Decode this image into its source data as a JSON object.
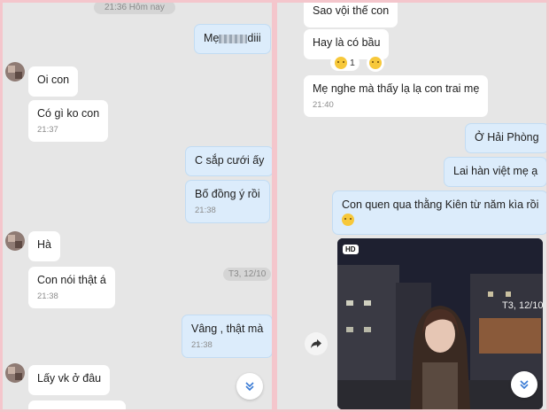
{
  "left": {
    "date_pill": "21:36 Hôm nay",
    "msg_me_prefix": "Mẹ",
    "msg_me_suffix": "diii",
    "msg_oicon": "Oi con",
    "msg_cogi": "Có gì ko con",
    "time_2137": "21:37",
    "msg_csap": "C sắp cưới ấy",
    "msg_bodong": "Bố đồng ý rồi",
    "time_2138a": "21:38",
    "msg_ha": "Hà",
    "msg_connoi": "Con nói thật á",
    "time_2138b": "21:38",
    "date_pill2": "T3, 12/10",
    "msg_vang": "Vâng , thật mà",
    "time_2138c": "21:38",
    "msg_layvk": "Lấy vk ở đâu"
  },
  "right": {
    "msg_saovoi": "Sao vội thế con",
    "msg_haylaco": "Hay là có bầu",
    "reaction_count": "1",
    "msg_menghe": "Mẹ nghe mà thấy lạ lạ con trai mẹ",
    "time_2140": "21:40",
    "msg_ohaiphong": "Ở Hải Phòng",
    "msg_laihan": "Lai hàn việt mẹ ạ",
    "msg_conquen": "Con quen qua thằng Kiên từ năm kìa rồi",
    "hd_badge": "HD",
    "photo_sign": "T3, 12/10"
  },
  "colors": {
    "background": "#f4c6cc",
    "panel": "#e6e6e6",
    "incoming": "#ffffff",
    "outgoing": "#dcecfb"
  }
}
